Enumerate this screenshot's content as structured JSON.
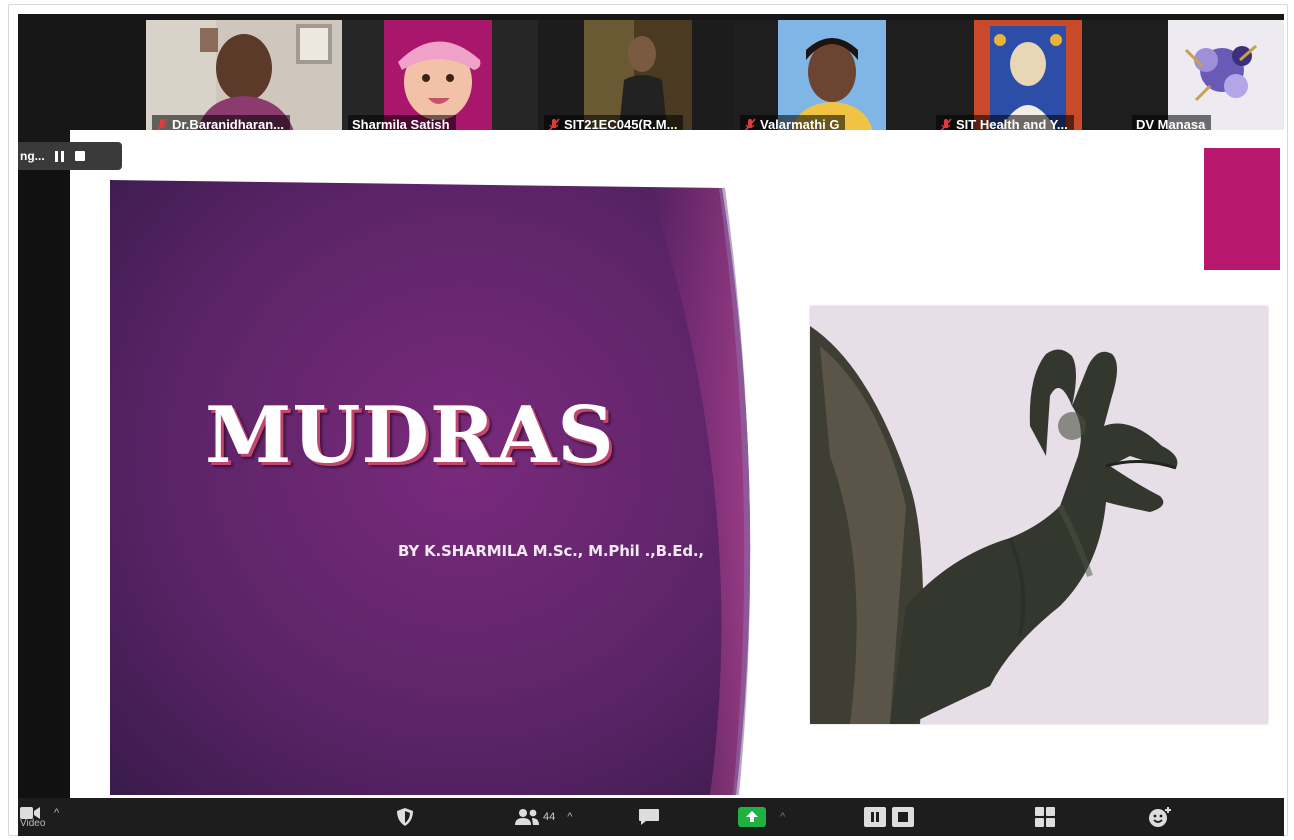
{
  "participants": [
    {
      "name": "Dr.Baranidharan...",
      "muted": true,
      "active": false
    },
    {
      "name": "Sharmila Satish",
      "muted": false,
      "active": true
    },
    {
      "name": "SIT21EC045(R.M...",
      "muted": true,
      "active": false
    },
    {
      "name": "Valarmathi G",
      "muted": true,
      "active": false
    },
    {
      "name": "SIT Health and Y...",
      "muted": true,
      "active": false
    },
    {
      "name": "DV Manasa",
      "muted": false,
      "active": false
    }
  ],
  "share_bar": {
    "label": "ng..."
  },
  "slide": {
    "title": "MUDRAS",
    "author": "BY K.SHARMILA M.Sc., M.Phil .,B.Ed.,"
  },
  "toolbar": {
    "video_label": "Video",
    "participants_count": "44"
  },
  "colors": {
    "slide_purple": "#5a2466",
    "accent_pink": "#b8176e",
    "share_green": "#1fb141",
    "active_speaker": "#e9f23c"
  },
  "icons": [
    "video-camera-icon",
    "chevron-up-icon",
    "security-shield-icon",
    "participants-icon",
    "chat-icon",
    "share-screen-icon",
    "pause-share-icon",
    "stop-share-icon",
    "apps-icon",
    "reactions-icon",
    "mic-muted-icon"
  ]
}
